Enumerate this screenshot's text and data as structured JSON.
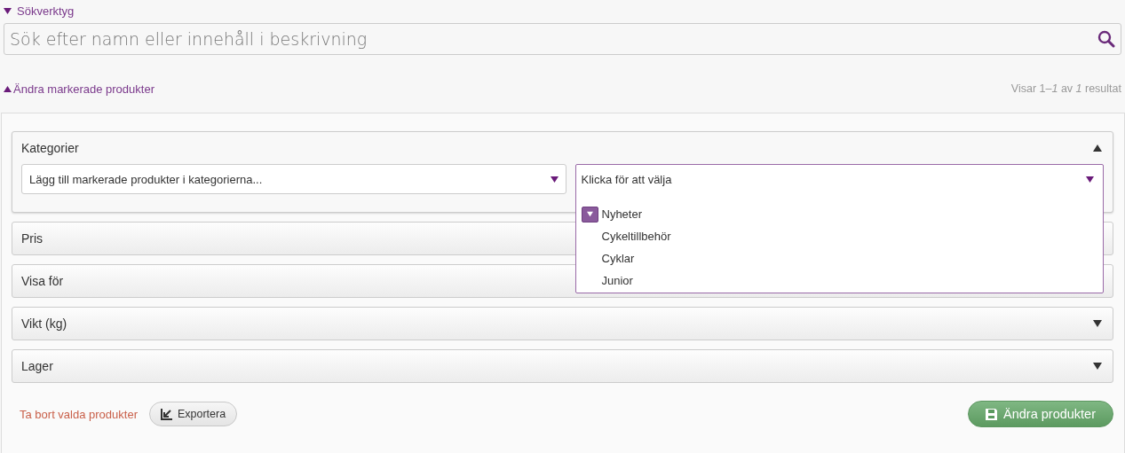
{
  "search_tools": {
    "label": "Sökverktyg",
    "expanded": true,
    "search": {
      "placeholder": "Sök efter namn eller innehåll i beskrivning"
    }
  },
  "bulk_edit": {
    "label": "Ändra markerade produkter",
    "expanded": true
  },
  "result_count": "Visar 1–*1* av *1* resultat",
  "panels": [
    {
      "title": "Kategorier",
      "expanded": true,
      "action_select": {
        "value": "Lägg till markerade produkter i kategorierna..."
      },
      "category_select": {
        "placeholder": "Klicka för att välja",
        "open": true,
        "options": [
          {
            "label": "Nyheter",
            "kind": "group"
          },
          {
            "label": "Cykeltillbehör",
            "kind": "leaf"
          },
          {
            "label": "Cyklar",
            "kind": "leaf"
          },
          {
            "label": "Junior",
            "kind": "leaf"
          }
        ]
      }
    },
    {
      "title": "Pris"
    },
    {
      "title": "Visa för"
    },
    {
      "title": "Vikt (kg)",
      "expanded": false
    },
    {
      "title": "Lager",
      "expanded": false
    }
  ],
  "remove_link": "Ta bort valda produkter",
  "export_button": "Exportera",
  "save_button": "Ändra produkter"
}
